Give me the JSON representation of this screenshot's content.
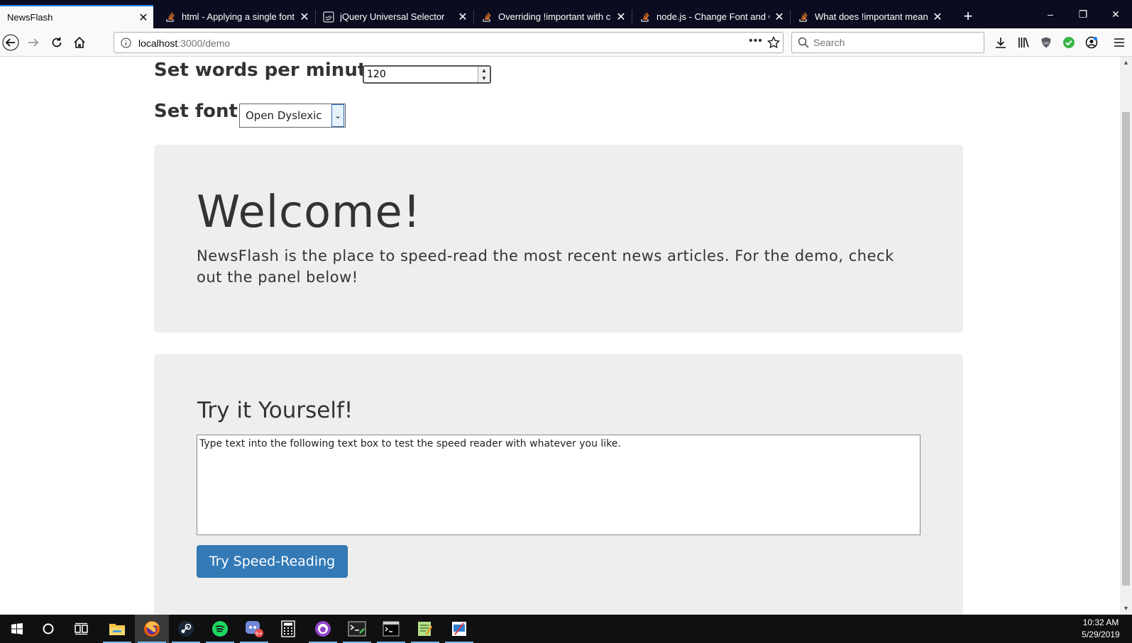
{
  "browser": {
    "tabs": [
      {
        "title": "NewsFlash",
        "active": true,
        "favicon": "none"
      },
      {
        "title": "html - Applying a single font to",
        "favicon": "stackoverflow-icon"
      },
      {
        "title": "jQuery Universal Selector",
        "favicon": "jquery-icon"
      },
      {
        "title": "Overriding !important with css",
        "favicon": "stackoverflow-icon"
      },
      {
        "title": "node.js - Change Font and Col",
        "favicon": "stackoverflow-icon"
      },
      {
        "title": "What does !important mean in",
        "favicon": "stackoverflow-icon"
      }
    ],
    "url": {
      "host": "localhost",
      "path": ":3000/demo"
    },
    "search_placeholder": "Search",
    "accent": "#0a84ff"
  },
  "controls": {
    "wpm_label": "Set words per minute:",
    "wpm_value": "120",
    "font_label": "Set font:",
    "font_selected": "Open Dyslexic"
  },
  "welcome": {
    "title": "Welcome!",
    "text": "NewsFlash is the place to speed-read the most recent news articles. For the demo, check out the panel below!"
  },
  "try": {
    "title": "Try it Yourself!",
    "textarea_value": "Type text into the following text box to test the speed reader with whatever you like.",
    "button_label": "Try Speed-Reading",
    "button_color": "#337ab7"
  },
  "taskbar": {
    "apps": [
      "start-icon",
      "cortana-icon",
      "task-view-icon",
      "file-explorer-icon",
      "firefox-icon",
      "steam-icon",
      "spotify-icon",
      "discord-icon",
      "calculator-icon",
      "app-icon",
      "terminal-icon",
      "cmd-icon",
      "notepad-icon",
      "screenshot-icon"
    ],
    "discord_badge": "9+",
    "time": "10:32 AM",
    "date": "5/29/2019"
  }
}
